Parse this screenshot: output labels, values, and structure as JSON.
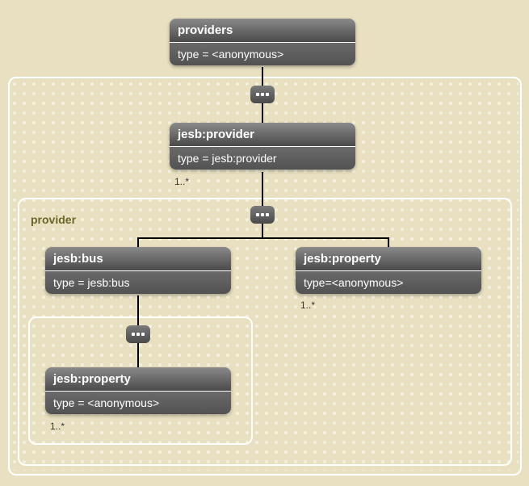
{
  "group_label": "provider",
  "nodes": {
    "providers": {
      "title": "providers",
      "type": "type = <anonymous>"
    },
    "provider": {
      "title": "jesb:provider",
      "type": "type = jesb:provider",
      "card": "1..*"
    },
    "bus": {
      "title": "jesb:bus",
      "type": "type = jesb:bus"
    },
    "property_right": {
      "title": "jesb:property",
      "type": "type=<anonymous>",
      "card": "1..*"
    },
    "property_nested": {
      "title": "jesb:property",
      "type": "type = <anonymous>",
      "card": "1..*"
    }
  }
}
